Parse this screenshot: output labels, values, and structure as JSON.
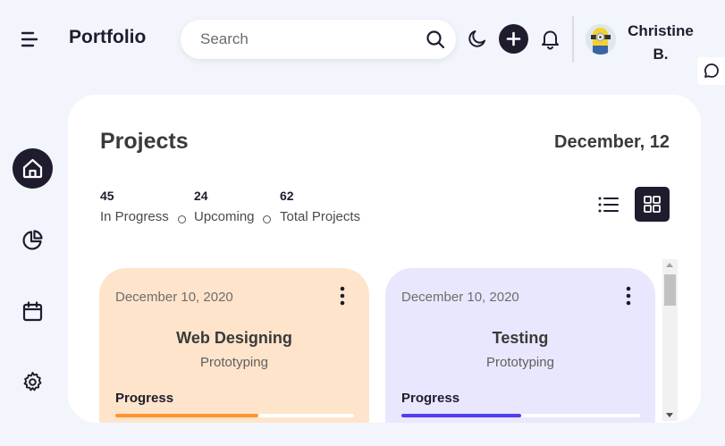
{
  "header": {
    "app_title": "Portfolio",
    "search": {
      "placeholder": "Search",
      "value": ""
    },
    "icons": [
      "menu-icon",
      "search-icon",
      "moon-icon",
      "plus-icon",
      "bell-icon",
      "message-icon"
    ],
    "user": {
      "name": "Christine B."
    }
  },
  "sidebar": {
    "items": [
      {
        "icon": "home-icon",
        "active": true
      },
      {
        "icon": "pie-chart-icon",
        "active": false
      },
      {
        "icon": "calendar-icon",
        "active": false
      },
      {
        "icon": "settings-icon",
        "active": false
      }
    ]
  },
  "main": {
    "title": "Projects",
    "date": "December, 12",
    "stats": [
      {
        "value": "45",
        "label": "In Progress"
      },
      {
        "value": "24",
        "label": "Upcoming"
      },
      {
        "value": "62",
        "label": "Total Projects"
      }
    ],
    "view_modes": {
      "list_icon": "list-icon",
      "grid_icon": "grid-icon",
      "active": "grid"
    },
    "projects": [
      {
        "date": "December 10, 2020",
        "title": "Web Designing",
        "subtitle": "Prototyping",
        "progress_label": "Progress",
        "progress": 0.6,
        "bg_color": "#fee4cb",
        "bar_color": "#ff942e"
      },
      {
        "date": "December 10, 2020",
        "title": "Testing",
        "subtitle": "Prototyping",
        "progress_label": "Progress",
        "progress": 0.5,
        "bg_color": "#e9e7fd",
        "bar_color": "#4f3ff0"
      }
    ]
  },
  "colors": {
    "background": "#f3f5fd",
    "dark": "#1f1c2e",
    "panel": "#ffffff"
  }
}
